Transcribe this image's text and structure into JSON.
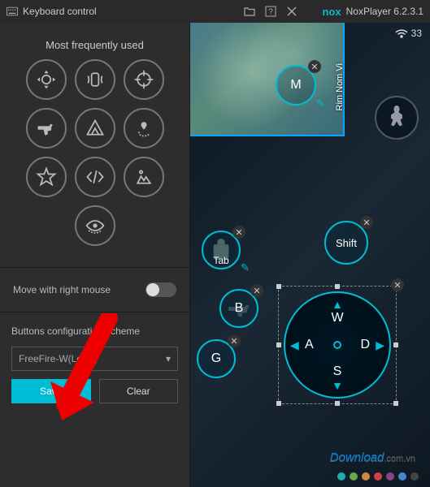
{
  "titlebar": {
    "title": "Keyboard control",
    "app_brand": "nox",
    "app_name": "NoxPlayer 6.2.3.1"
  },
  "panel": {
    "freq_header": "Most frequently used",
    "move_label": "Move with right mouse",
    "scheme_label": "Buttons configuration scheme",
    "scheme_value": "FreeFire-W(Local)",
    "save_label": "Save",
    "clear_label": "Clear",
    "tools": [
      "dpad",
      "tilt",
      "sight",
      "shoot",
      "macro",
      "path",
      "star",
      "script",
      "scenery",
      "vision"
    ]
  },
  "game": {
    "wifi_signal": "33",
    "map_region": "Rim Nom Vi",
    "watermark": "Download",
    "watermark_suffix": ".com.vn",
    "key_bindings": {
      "m": "M",
      "tab": "Tab",
      "shift": "Shift",
      "b": "B",
      "g": "G",
      "dpad_up": "W",
      "dpad_left": "A",
      "dpad_right": "D",
      "dpad_down": "S"
    },
    "theme_dots": [
      "#2aa",
      "#6a4",
      "#c84",
      "#c44",
      "#848",
      "#48c",
      "#444"
    ]
  }
}
